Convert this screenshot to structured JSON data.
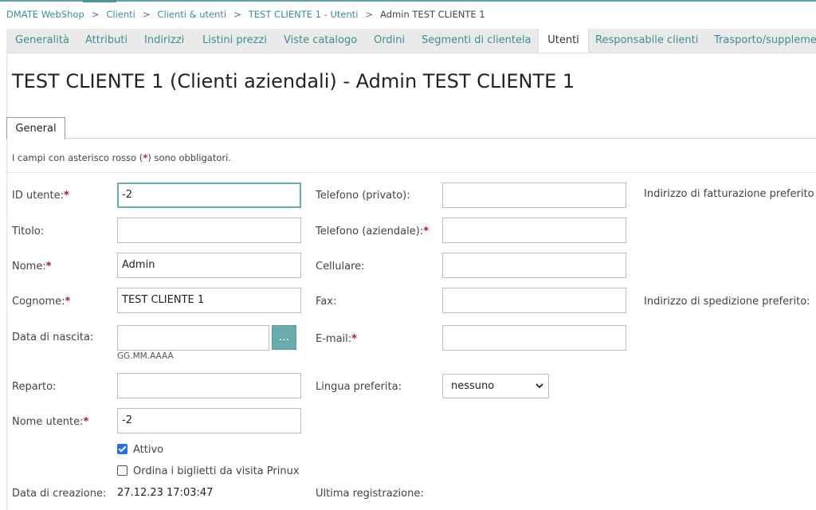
{
  "breadcrumb": [
    "DMATE WebShop",
    "Clienti",
    "Clienti & utenti",
    "TEST CLIENTE 1 - Utenti",
    "Admin TEST CLIENTE 1"
  ],
  "breadcrumb_separator": ">",
  "tabs": [
    "Generalità",
    "Attributi",
    "Indirizzi",
    "Listini prezzi",
    "Viste catalogo",
    "Ordini",
    "Segmenti di clientela",
    "Utenti",
    "Responsabile clienti",
    "Trasporto/supplementi"
  ],
  "active_tab": "Utenti",
  "page_title": "TEST CLIENTE 1 (Clienti aziendali) - Admin TEST CLIENTE 1",
  "subtab": "General",
  "note": {
    "before": "I campi con asterisco rosso (",
    "star": "*",
    "after": ") sono obbligatori."
  },
  "required_marker": "*",
  "form": {
    "user_id": {
      "label": "ID utente:",
      "value": "-2"
    },
    "title": {
      "label": "Titolo:",
      "value": ""
    },
    "first_name": {
      "label": "Nome:",
      "value": "Admin"
    },
    "last_name": {
      "label": "Cognome:",
      "value": "TEST CLIENTE 1"
    },
    "birth_date": {
      "label": "Data di nascita:",
      "value": "",
      "hint": "GG.MM.AAAA",
      "button": "..."
    },
    "department": {
      "label": "Reparto:",
      "value": ""
    },
    "username": {
      "label": "Nome utente:",
      "value": "-2"
    },
    "active": {
      "label": "Attivo",
      "checked": true
    },
    "business_cards": {
      "label": "Ordina i biglietti da visita Prinux",
      "checked": false
    },
    "created": {
      "label": "Data di creazione:",
      "value": "27.12.23 17:03:47"
    },
    "phone_private": {
      "label": "Telefono (privato):",
      "value": ""
    },
    "phone_business": {
      "label": "Telefono (aziendale):",
      "value": ""
    },
    "mobile": {
      "label": "Cellulare:",
      "value": ""
    },
    "fax": {
      "label": "Fax:",
      "value": ""
    },
    "email": {
      "label": "E-mail:",
      "value": ""
    },
    "language": {
      "label": "Lingua preferita:",
      "value": "nessuno"
    },
    "last_login": {
      "label": "Ultima registrazione:",
      "value": ""
    },
    "billing_address": {
      "label": "Indirizzo di fatturazione preferito"
    },
    "shipping_address": {
      "label": "Indirizzo di spedizione preferito:"
    }
  },
  "colors": {
    "accent": "#5ea3a6",
    "link": "#3b8f94",
    "required": "#b0182e",
    "checkbox": "#2a6ed9"
  }
}
